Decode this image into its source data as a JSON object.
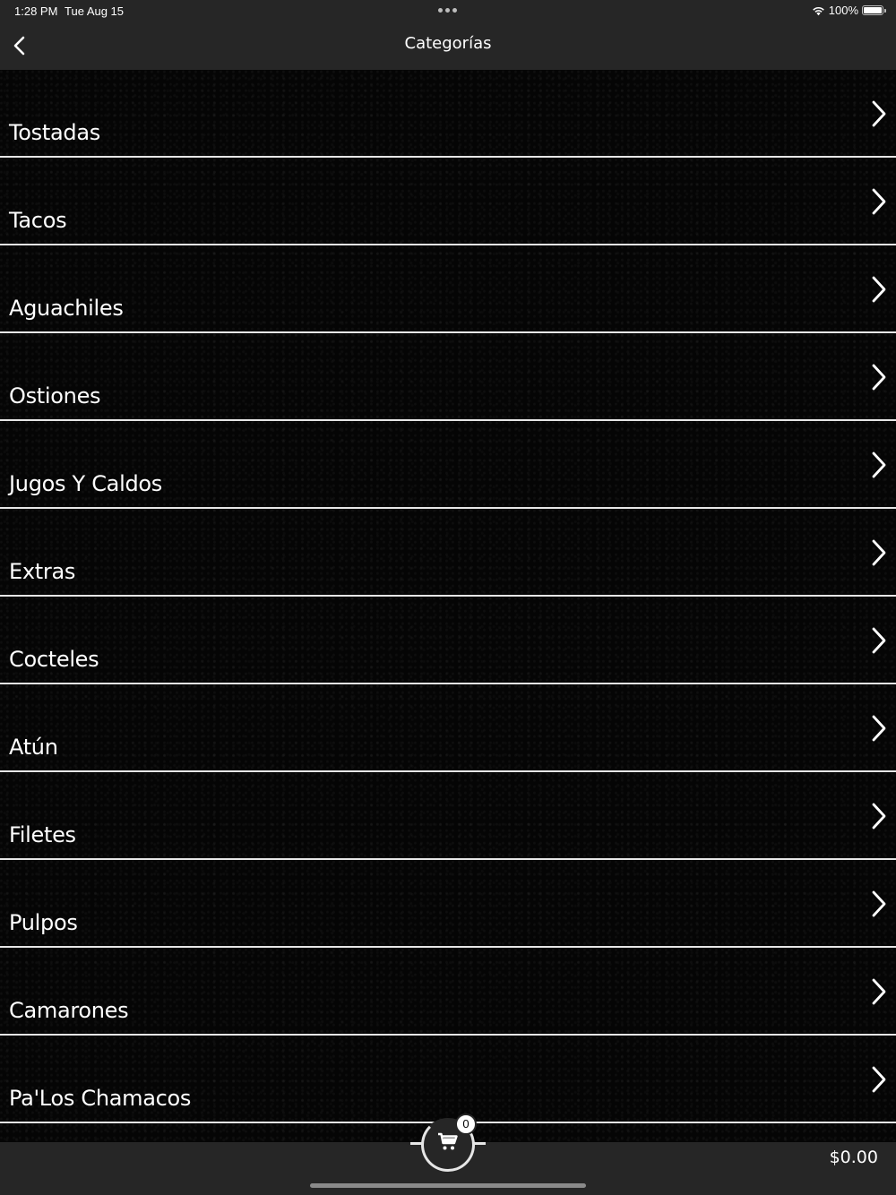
{
  "status_bar": {
    "time": "1:28 PM",
    "date": "Tue Aug 15",
    "battery": "100%",
    "battery_level": 1.0,
    "wifi_icon": "wifi-icon",
    "battery_icon": "battery-icon"
  },
  "nav": {
    "title": "Categorías",
    "back_icon": "chevron-left-icon"
  },
  "categories": [
    {
      "label": "Tostadas"
    },
    {
      "label": "Tacos"
    },
    {
      "label": "Aguachiles"
    },
    {
      "label": "Ostiones"
    },
    {
      "label": "Jugos Y Caldos"
    },
    {
      "label": "Extras"
    },
    {
      "label": "Cocteles"
    },
    {
      "label": "Atún"
    },
    {
      "label": "Filetes"
    },
    {
      "label": "Pulpos"
    },
    {
      "label": "Camarones"
    },
    {
      "label": "Pa'Los Chamacos"
    }
  ],
  "cart": {
    "count": "0",
    "icon": "cart-icon",
    "total": "$0.00"
  },
  "colors": {
    "bar_background": "#262626",
    "list_background": "#050505",
    "divider": "#e6e6e6",
    "text": "#ffffff"
  }
}
